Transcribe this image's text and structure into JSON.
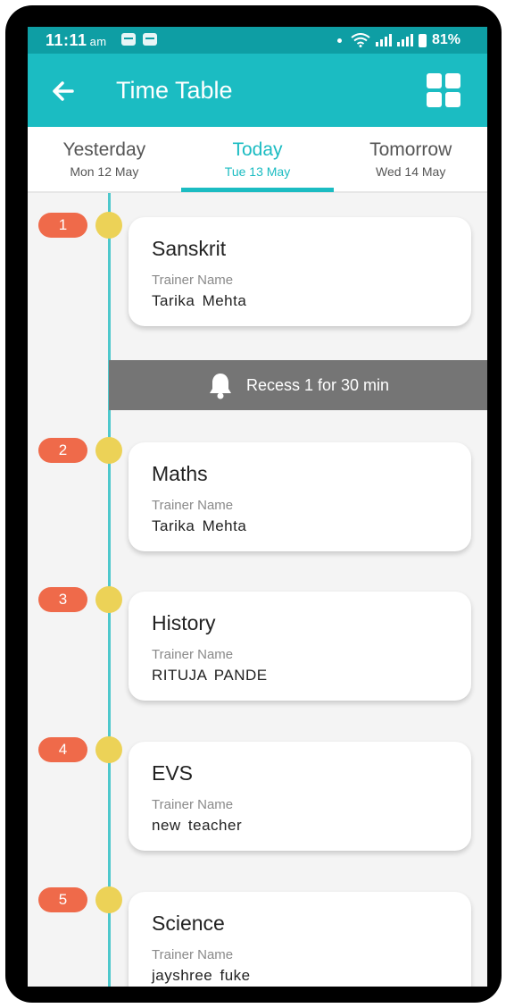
{
  "status_bar": {
    "time": "11:11",
    "ampm": "am",
    "battery": "81%"
  },
  "header": {
    "title": "Time Table",
    "back_icon": "arrow-left-icon",
    "menu_icon": "grid-icon"
  },
  "tabs": [
    {
      "day": "Yesterday",
      "date": "Mon 12 May",
      "active": false
    },
    {
      "day": "Today",
      "date": "Tue 13 May",
      "active": true
    },
    {
      "day": "Tomorrow",
      "date": "Wed 14 May",
      "active": false
    }
  ],
  "recess": {
    "text": "Recess 1 for 30 min",
    "icon": "bell-icon"
  },
  "periods": [
    {
      "number": "1",
      "subject": "Sanskrit",
      "trainer_label": "Trainer Name",
      "trainer": "Tarika  Mehta"
    },
    {
      "number": "2",
      "subject": "Maths",
      "trainer_label": "Trainer Name",
      "trainer": "Tarika  Mehta"
    },
    {
      "number": "3",
      "subject": "History",
      "trainer_label": "Trainer Name",
      "trainer": "RITUJA  PANDE"
    },
    {
      "number": "4",
      "subject": "EVS",
      "trainer_label": "Trainer Name",
      "trainer": "new  teacher"
    },
    {
      "number": "5",
      "subject": "Science",
      "trainer_label": "Trainer Name",
      "trainer": "jayshree  fuke"
    }
  ],
  "colors": {
    "status_bar": "#0e9ea4",
    "app_bar": "#1bbcc2",
    "badge": "#ef6a4a",
    "dot": "#ecd257",
    "recess": "#757575"
  }
}
